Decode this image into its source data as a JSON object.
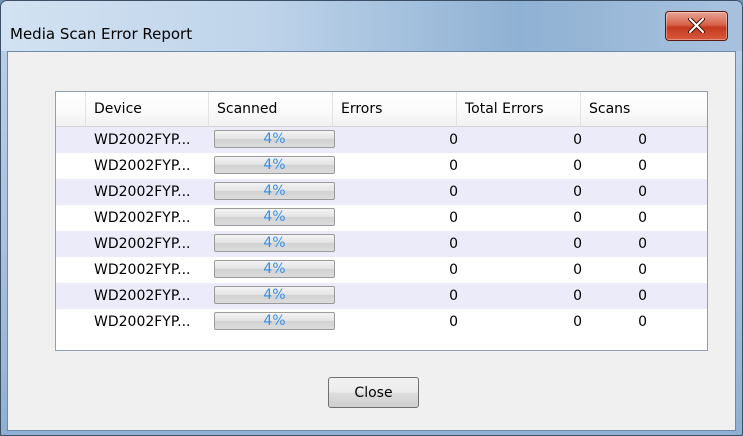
{
  "window": {
    "title": "Media Scan Error Report",
    "close_glyph": "x-icon"
  },
  "table": {
    "columns": [
      "Device",
      "Scanned",
      "Errors",
      "Total Errors",
      "Scans"
    ],
    "rows": [
      {
        "device": "WD2002FYP...",
        "scanned": "4%",
        "scanned_value": 0.04,
        "errors": "0",
        "total_errors": "0",
        "scans": "0"
      },
      {
        "device": "WD2002FYP...",
        "scanned": "4%",
        "scanned_value": 0.04,
        "errors": "0",
        "total_errors": "0",
        "scans": "0"
      },
      {
        "device": "WD2002FYP...",
        "scanned": "4%",
        "scanned_value": 0.04,
        "errors": "0",
        "total_errors": "0",
        "scans": "0"
      },
      {
        "device": "WD2002FYP...",
        "scanned": "4%",
        "scanned_value": 0.04,
        "errors": "0",
        "total_errors": "0",
        "scans": "0"
      },
      {
        "device": "WD2002FYP...",
        "scanned": "4%",
        "scanned_value": 0.04,
        "errors": "0",
        "total_errors": "0",
        "scans": "0"
      },
      {
        "device": "WD2002FYP...",
        "scanned": "4%",
        "scanned_value": 0.04,
        "errors": "0",
        "total_errors": "0",
        "scans": "0"
      },
      {
        "device": "WD2002FYP...",
        "scanned": "4%",
        "scanned_value": 0.04,
        "errors": "0",
        "total_errors": "0",
        "scans": "0"
      },
      {
        "device": "WD2002FYP...",
        "scanned": "4%",
        "scanned_value": 0.04,
        "errors": "0",
        "total_errors": "0",
        "scans": "0"
      }
    ]
  },
  "footer": {
    "close_label": "Close"
  },
  "colors": {
    "alt_row": "#ebebfa",
    "progress_text": "#3a8fe6",
    "progress_fill": "#3d7de0",
    "close_button_red": "#c43a20"
  }
}
